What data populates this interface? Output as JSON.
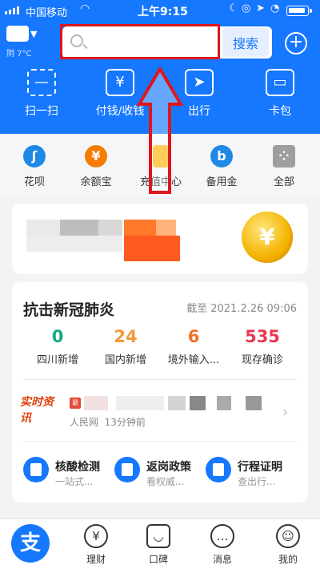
{
  "status": {
    "carrier": "中国移动",
    "time": "上午9:15"
  },
  "weather": {
    "text": "阴 7°C"
  },
  "search": {
    "placeholder": "",
    "button_label": "搜索"
  },
  "quick_actions": [
    {
      "label": "扫一扫",
      "icon": "scan-icon"
    },
    {
      "label": "付钱/收钱",
      "icon": "payment-icon"
    },
    {
      "label": "出行",
      "icon": "travel-icon"
    },
    {
      "label": "卡包",
      "icon": "card-wallet-icon"
    }
  ],
  "grid": [
    {
      "label": "花呗",
      "icon": "huabei-icon",
      "color": "#1e88e5"
    },
    {
      "label": "余额宝",
      "icon": "yuebao-icon",
      "color": "#f57c00"
    },
    {
      "label": "充值中心",
      "icon": "recharge-icon",
      "color": "#ffb300"
    },
    {
      "label": "备用金",
      "icon": "reserve-fund-icon",
      "color": "#1e88e5"
    },
    {
      "label": "全部",
      "icon": "all-apps-icon",
      "color": "#9e9e9e"
    }
  ],
  "banner": {
    "coin_symbol": "¥"
  },
  "covid": {
    "title": "抗击新冠肺炎",
    "date": "截至 2021.2.26 09:06",
    "stats": [
      {
        "value": "0",
        "label": "四川新增",
        "color": "#13a889"
      },
      {
        "value": "24",
        "label": "国内新增",
        "color": "#f29a3c"
      },
      {
        "value": "6",
        "label": "境外输入...",
        "color": "#f0712c"
      },
      {
        "value": "535",
        "label": "现存确诊",
        "color": "#e8384f"
      }
    ],
    "news": {
      "logo": "实时资讯",
      "source": "人民网",
      "age": "13分钟前"
    },
    "services": [
      {
        "title": "核酸检测",
        "subtitle": "一站式...",
        "icon": "nucleic-test-icon"
      },
      {
        "title": "返岗政策",
        "subtitle": "看权威...",
        "icon": "return-policy-icon"
      },
      {
        "title": "行程证明",
        "subtitle": "查出行...",
        "icon": "travel-proof-icon"
      }
    ]
  },
  "tabbar": [
    {
      "label": "",
      "icon": "alipay-home-icon"
    },
    {
      "label": "理财",
      "icon": "wealth-icon"
    },
    {
      "label": "口碑",
      "icon": "koubei-icon"
    },
    {
      "label": "消息",
      "icon": "message-icon"
    },
    {
      "label": "我的",
      "icon": "profile-icon"
    }
  ],
  "colors": {
    "brand": "#1677ff",
    "highlight": "#e0161d"
  }
}
